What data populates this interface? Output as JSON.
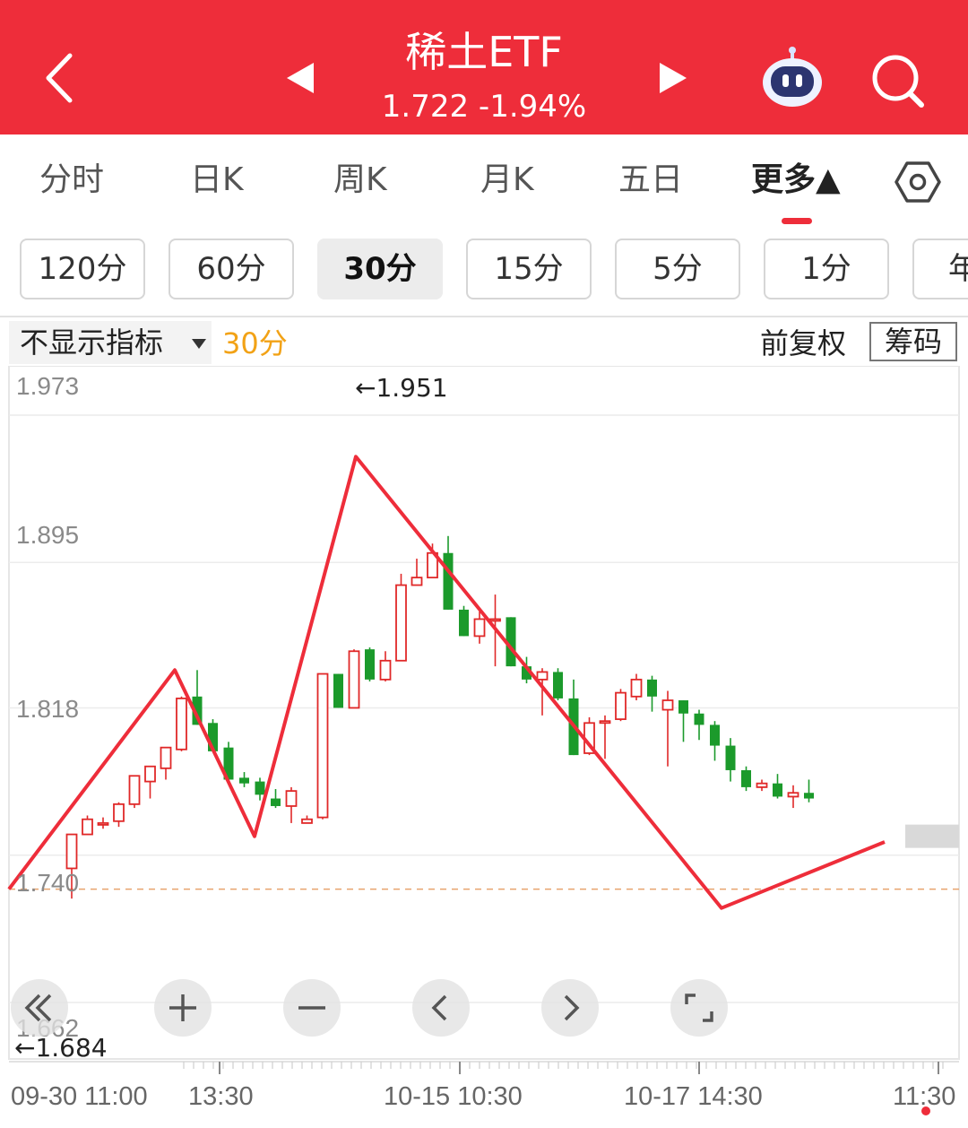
{
  "header": {
    "title": "稀土ETF",
    "subtitle": "1.722 -1.94%",
    "colors": {
      "background": "#ee2d3a",
      "text": "#ffffff"
    },
    "icons": [
      "back-icon",
      "prev-icon",
      "next-icon",
      "robot-icon",
      "search-icon"
    ]
  },
  "tabs": [
    {
      "label": "分时"
    },
    {
      "label": "日K"
    },
    {
      "label": "周K"
    },
    {
      "label": "月K"
    },
    {
      "label": "五日"
    },
    {
      "label": "更多▲"
    }
  ],
  "active_tab": "更多▲",
  "periods": [
    {
      "label": "120分"
    },
    {
      "label": "60分"
    },
    {
      "label": "30分"
    },
    {
      "label": "15分"
    },
    {
      "label": "5分"
    },
    {
      "label": "1分"
    },
    {
      "label": "年"
    }
  ],
  "active_period": "30分",
  "indicator_bar": {
    "select_label": "不显示指标",
    "period_label": "30分",
    "adjust_label": "前复权",
    "chip_label": "筹码"
  },
  "chart_data": {
    "type": "candlestick",
    "y_ticks": [
      "1.973",
      "1.895",
      "1.818",
      "1.740",
      "1.662"
    ],
    "x_ticks": [
      "09-30 11:00",
      "13:30",
      "10-15 10:30",
      "10-17 14:30",
      "11:30"
    ],
    "high_label": "←1.951",
    "low_label": "←1.684",
    "high_value": 1.951,
    "low_value": 1.684,
    "ylim": [
      1.662,
      1.973
    ],
    "reference_price": 1.722,
    "colors": {
      "up": "#e02828",
      "down": "#1b9a2b",
      "zigzag": "#ee2d3a",
      "reference": "#e8a36e"
    },
    "zigzag_points": [
      {
        "bar": -1,
        "value": 1.722
      },
      {
        "bar": 8,
        "value": 1.838
      },
      {
        "bar": 15,
        "value": 1.75
      },
      {
        "bar": 22,
        "value": 1.951
      },
      {
        "bar": 47,
        "value": 1.712
      },
      {
        "bar": 54,
        "value": 1.747
      }
    ],
    "candles": [
      [
        1.733,
        1.751,
        1.717,
        1.751
      ],
      [
        1.751,
        1.761,
        1.751,
        1.759
      ],
      [
        1.757,
        1.76,
        1.754,
        1.757
      ],
      [
        1.758,
        1.768,
        1.755,
        1.767
      ],
      [
        1.767,
        1.782,
        1.765,
        1.782
      ],
      [
        1.779,
        1.787,
        1.77,
        1.787
      ],
      [
        1.786,
        1.797,
        1.78,
        1.797
      ],
      [
        1.796,
        1.824,
        1.795,
        1.823
      ],
      [
        1.824,
        1.838,
        1.823,
        1.809
      ],
      [
        1.81,
        1.812,
        1.795,
        1.795
      ],
      [
        1.797,
        1.8,
        1.778,
        1.78
      ],
      [
        1.781,
        1.784,
        1.776,
        1.778
      ],
      [
        1.779,
        1.781,
        1.769,
        1.772
      ],
      [
        1.77,
        1.775,
        1.765,
        1.766
      ],
      [
        1.766,
        1.776,
        1.757,
        1.774
      ],
      [
        1.757,
        1.761,
        1.757,
        1.759
      ],
      [
        1.76,
        1.787,
        1.759,
        1.836
      ],
      [
        1.836,
        1.814,
        1.819,
        1.818
      ],
      [
        1.818,
        1.849,
        1.821,
        1.848
      ],
      [
        1.849,
        1.85,
        1.832,
        1.833
      ],
      [
        1.833,
        1.848,
        1.832,
        1.843
      ],
      [
        1.843,
        1.889,
        1.846,
        1.883
      ],
      [
        1.883,
        1.897,
        1.883,
        1.887
      ],
      [
        1.887,
        1.905,
        1.891,
        1.9
      ],
      [
        1.9,
        1.909,
        1.87,
        1.87
      ],
      [
        1.87,
        1.872,
        1.856,
        1.856
      ],
      [
        1.856,
        1.869,
        1.852,
        1.865
      ],
      [
        1.865,
        1.878,
        1.84,
        1.865
      ],
      [
        1.866,
        1.846,
        1.84,
        1.84
      ],
      [
        1.84,
        1.845,
        1.831,
        1.833
      ],
      [
        1.833,
        1.839,
        1.814,
        1.837
      ],
      [
        1.837,
        1.839,
        1.822,
        1.823
      ],
      [
        1.823,
        1.833,
        1.794,
        1.793
      ],
      [
        1.794,
        1.813,
        1.793,
        1.81
      ],
      [
        1.81,
        1.814,
        1.791,
        1.811
      ],
      [
        1.812,
        1.828,
        1.811,
        1.826
      ],
      [
        1.824,
        1.836,
        1.822,
        1.833
      ],
      [
        1.833,
        1.835,
        1.816,
        1.824
      ],
      [
        1.817,
        1.827,
        1.787,
        1.822
      ],
      [
        1.822,
        1.821,
        1.8,
        1.815
      ],
      [
        1.815,
        1.817,
        1.801,
        1.809
      ],
      [
        1.809,
        1.811,
        1.79,
        1.798
      ],
      [
        1.798,
        1.802,
        1.779,
        1.785
      ],
      [
        1.785,
        1.787,
        1.774,
        1.776
      ],
      [
        1.776,
        1.78,
        1.774,
        1.778
      ],
      [
        1.778,
        1.783,
        1.77,
        1.771
      ],
      [
        1.771,
        1.777,
        1.765,
        1.773
      ],
      [
        1.773,
        1.78,
        1.768,
        1.77
      ]
    ]
  },
  "chart_controls": [
    "collapse-left-button",
    "zoom-in-button",
    "zoom-out-button",
    "scroll-left-button",
    "scroll-right-button",
    "fullscreen-button"
  ]
}
